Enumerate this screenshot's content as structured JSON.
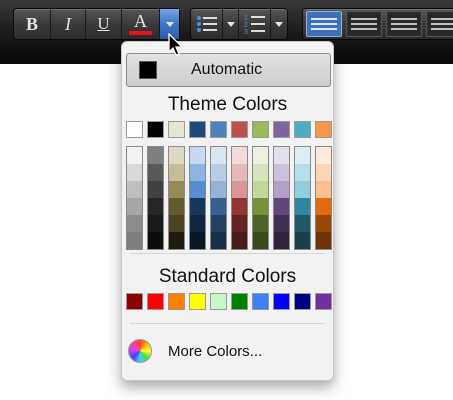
{
  "toolbar": {
    "bold_label": "B",
    "italic_label": "I",
    "underline_label": "U",
    "font_color_label": "A",
    "font_color_current": "#e8131b",
    "style_thumbs_count_selected": "1"
  },
  "dropdown": {
    "automatic_label": "Automatic",
    "automatic_color": "#000000",
    "theme_title": "Theme Colors",
    "theme_base": [
      "#ffffff",
      "#000000",
      "#e6e6d6",
      "#1f497d",
      "#4f81bd",
      "#c0504d",
      "#9bbb59",
      "#8064a2",
      "#4bacc6",
      "#f79646"
    ],
    "theme_shades": [
      [
        "#f2f2f2",
        "#d9d9d9",
        "#bfbfbf",
        "#a6a6a6",
        "#8c8c8c",
        "#7f7f7f"
      ],
      [
        "#7f7f7f",
        "#595959",
        "#404040",
        "#262626",
        "#1a1a1a",
        "#0d0d0d"
      ],
      [
        "#ddd9c4",
        "#c4bd97",
        "#948a54",
        "#625b2c",
        "#4a4520",
        "#1d1b10"
      ],
      [
        "#c6d9f1",
        "#8db3e2",
        "#548dd4",
        "#17375e",
        "#10253f",
        "#0a1826"
      ],
      [
        "#dbe5f1",
        "#b8cce4",
        "#95b3d7",
        "#366092",
        "#244062",
        "#16304a"
      ],
      [
        "#f2dcdb",
        "#e6b8b7",
        "#da9694",
        "#963634",
        "#632523",
        "#4a1b1a"
      ],
      [
        "#ebf1de",
        "#d8e4bc",
        "#c4d79b",
        "#76933c",
        "#4f6228",
        "#3b4a1e"
      ],
      [
        "#e4dfec",
        "#ccc0da",
        "#b1a0c7",
        "#60497a",
        "#403151",
        "#2f243c"
      ],
      [
        "#dbeef4",
        "#b7dee8",
        "#92cddc",
        "#31859c",
        "#215868",
        "#183f4a"
      ],
      [
        "#fde9d9",
        "#fcd5b4",
        "#fabf8f",
        "#e26b0a",
        "#974706",
        "#713504"
      ]
    ],
    "standard_title": "Standard Colors",
    "standard_colors": [
      "#8b0000",
      "#ff0000",
      "#ff8000",
      "#ffff00",
      "#c6f7c6",
      "#008000",
      "#3b82f6",
      "#0000ff",
      "#000080",
      "#7030a0"
    ],
    "more_colors_label": "More Colors..."
  }
}
